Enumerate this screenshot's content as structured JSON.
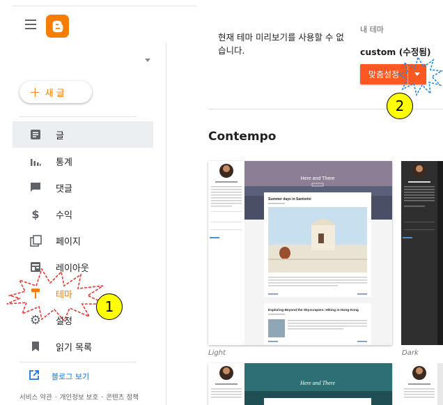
{
  "sidebar": {
    "new_post": "새 글",
    "items": [
      {
        "label": "글",
        "icon": "posts-icon"
      },
      {
        "label": "통계",
        "icon": "stats-icon"
      },
      {
        "label": "댓글",
        "icon": "comments-icon"
      },
      {
        "label": "수익",
        "icon": "dollar-icon"
      },
      {
        "label": "페이지",
        "icon": "pages-icon"
      },
      {
        "label": "레이아웃",
        "icon": "layout-icon"
      },
      {
        "label": "테마",
        "icon": "theme-paint-roller-icon"
      },
      {
        "label": "설정",
        "icon": "gear-icon"
      },
      {
        "label": "읽기 목록",
        "icon": "bookmark-icon"
      }
    ],
    "view_blog": "블로그 보기",
    "footer": {
      "terms": "서비스 약관",
      "privacy": "개인정보 보호",
      "content_policy": "콘텐츠 정책"
    }
  },
  "main": {
    "preview_unavailable": "현재 테마 미리보기를 사용할 수 없습니다.",
    "my_theme_label": "내 테마",
    "my_theme_name": "custom (수정됨)",
    "customize_button": "맞춤설정",
    "section_title": "Contempo",
    "themes": [
      {
        "caption": "Light",
        "blog_title": "Here and There",
        "post1_title": "Summer days in Santorini",
        "post2_title": "Exploring Beyond the Skyscrapers: Hiking in Hong Kong"
      },
      {
        "caption": "Dark"
      },
      {
        "blog_title": "Here and There"
      }
    ]
  },
  "annotations": {
    "marker1": "1",
    "marker2": "2"
  },
  "colors": {
    "accent": "#f57d00",
    "button": "#fd5722",
    "marker": "#ffff00",
    "link": "#1a73e8"
  }
}
